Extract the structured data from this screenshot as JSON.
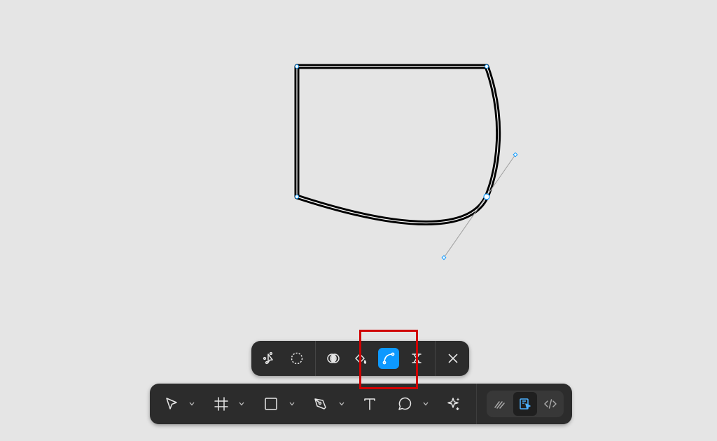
{
  "app": {
    "context": "vector-shape-edit-mode",
    "colors": {
      "canvas": "#e5e5e5",
      "toolbar": "#2c2c2c",
      "accent": "#0d99ff",
      "highlight": "#d00000",
      "icon": "#e6e6e6"
    }
  },
  "edit_toolbar": {
    "tools": [
      {
        "name": "multi-edit-tool",
        "icon": "multi-edit-icon",
        "active": false
      },
      {
        "name": "lasso-tool",
        "icon": "lasso-icon",
        "active": false
      },
      {
        "name": "shape-builder-tool",
        "icon": "shape-builder-icon",
        "active": false
      },
      {
        "name": "paint-bucket-tool",
        "icon": "paint-bucket-icon",
        "active": false
      },
      {
        "name": "bend-tool",
        "icon": "bend-icon",
        "active": true
      },
      {
        "name": "cut-tool",
        "icon": "cut-icon",
        "active": false
      },
      {
        "name": "done-button",
        "icon": "close-icon",
        "active": false
      }
    ]
  },
  "main_toolbar": {
    "tools": [
      {
        "name": "move-tool",
        "icon": "cursor-icon",
        "has_menu": true
      },
      {
        "name": "frame-tool",
        "icon": "hash-icon",
        "has_menu": true
      },
      {
        "name": "rectangle-tool",
        "icon": "rectangle-icon",
        "has_menu": true
      },
      {
        "name": "pen-tool",
        "icon": "pen-icon",
        "has_menu": true
      },
      {
        "name": "text-tool",
        "icon": "text-icon",
        "has_menu": false
      },
      {
        "name": "comment-tool",
        "icon": "comment-icon",
        "has_menu": true
      },
      {
        "name": "actions-tool",
        "icon": "sparkle-icon",
        "has_menu": false
      }
    ],
    "modes": [
      {
        "name": "draw-mode",
        "icon": "draw-icon",
        "active": false
      },
      {
        "name": "design-mode",
        "icon": "design-icon",
        "active": true
      },
      {
        "name": "dev-mode",
        "icon": "code-icon",
        "active": false
      }
    ]
  }
}
